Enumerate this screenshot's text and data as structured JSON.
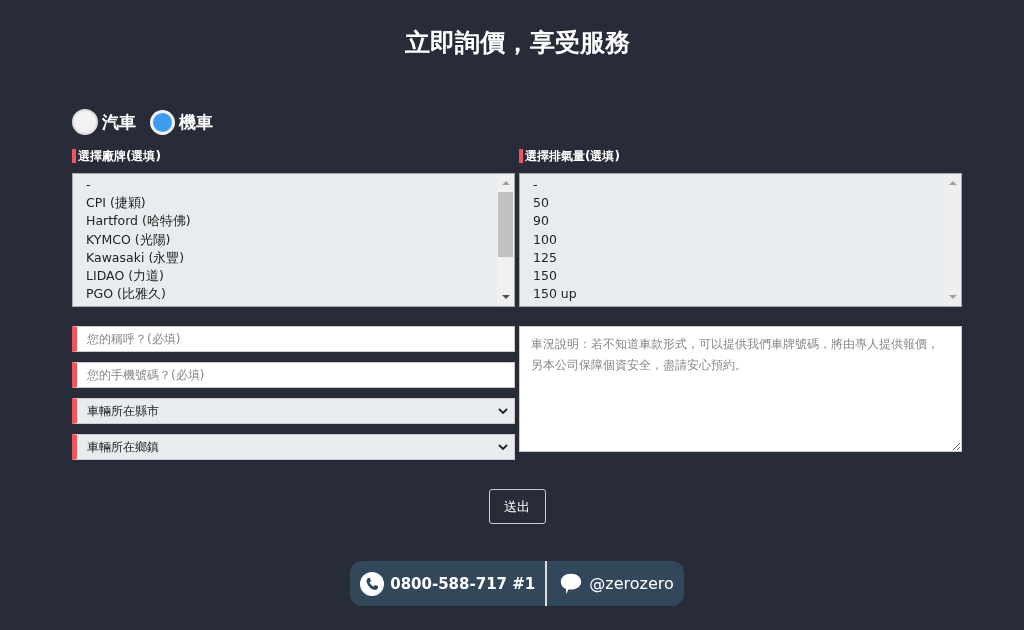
{
  "title": "立即詢價，享受服務",
  "vehicle_types": [
    {
      "label": "汽車",
      "selected": false
    },
    {
      "label": "機車",
      "selected": true
    }
  ],
  "brand_list": {
    "label": "選擇廠牌(選填)",
    "options": [
      "-",
      "CPI (捷穎)",
      "Hartford (哈特佛)",
      "KYMCO (光陽)",
      "Kawasaki (永豐)",
      "LIDAO (力道)",
      "PGO (比雅久)"
    ]
  },
  "displacement_list": {
    "label": "選擇排氣量(選填)",
    "options": [
      "-",
      "50",
      "90",
      "100",
      "125",
      "150",
      "150 up"
    ]
  },
  "name_field": {
    "placeholder": "您的稱呼？(必填)"
  },
  "phone_field": {
    "placeholder": "您的手機號碼？(必填)"
  },
  "city_select": {
    "value": "車輛所在縣市"
  },
  "town_select": {
    "value": "車輛所在鄉鎮"
  },
  "notes_field": {
    "placeholder": "車況說明：若不知道車款形式，可以提供我們車牌號碼，將由專人提供報價，另本公司保障個資安全，盡請安心預約。"
  },
  "submit_button": "送出",
  "contact": {
    "phone": "0800-588-717 #1",
    "line_id": "@zerozero"
  }
}
